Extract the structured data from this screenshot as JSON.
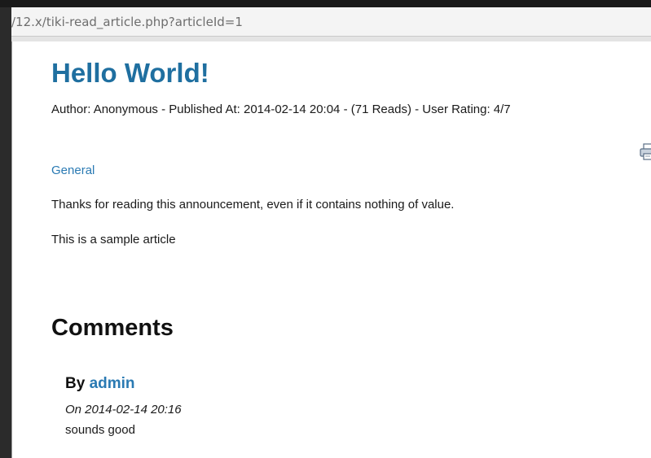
{
  "browser": {
    "url": "/12.x/tiki-read_article.php?articleId=1"
  },
  "article": {
    "title": "Hello World!",
    "meta": "Author: Anonymous - Published At: 2014-02-14 20:04 - (71 Reads) - User Rating: 4/7",
    "topic": "General",
    "heading": "Thanks for reading this announcement, even if it contains nothing of value.",
    "body": "This is a sample article",
    "print_icon": "printer-icon"
  },
  "comments": {
    "heading": "Comments",
    "items": [
      {
        "by_prefix": "By",
        "author": "admin",
        "date": "On 2014-02-14 20:16",
        "text": "sounds good"
      }
    ]
  },
  "colors": {
    "title": "#1f6fa0",
    "link": "#2a7ab3"
  }
}
